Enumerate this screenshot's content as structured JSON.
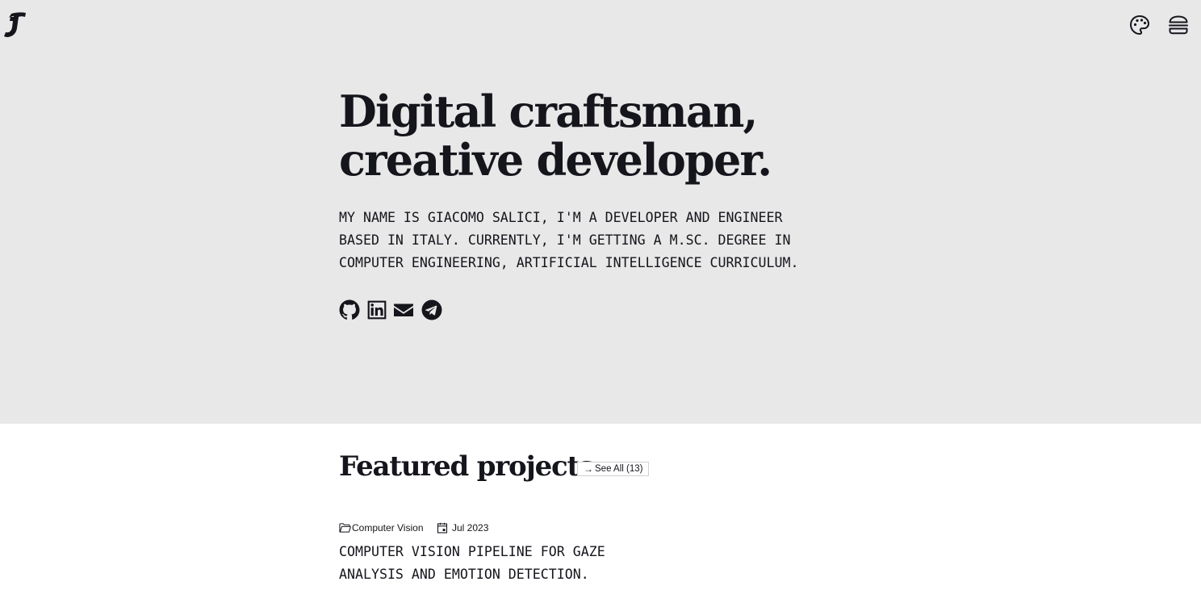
{
  "header": {
    "logo_icon": "script-j-logo-icon",
    "palette_icon": "palette-icon",
    "menu_icon": "hamburger-menu-icon"
  },
  "hero": {
    "headline_line1": "Digital craftsman,",
    "headline_line2": "creative developer.",
    "intro": "MY NAME IS GIACOMO SALICI, I'M A DEVELOPER AND ENGINEER BASED IN ITALY. CURRENTLY, I'M GETTING A M.SC. DEGREE IN COMPUTER ENGINEERING, ARTIFICIAL INTELLIGENCE CURRICULUM.",
    "socials": [
      "github-icon",
      "linkedin-icon",
      "mail-icon",
      "telegram-icon"
    ],
    "background": "#e8e8e8"
  },
  "featured": {
    "title": "Featured projects",
    "see_all_label": "See All (13)",
    "projects": [
      {
        "category": "Computer Vision",
        "date": "Jul 2023",
        "description": "COMPUTER VISION PIPELINE FOR GAZE ANALYSIS AND EMOTION DETECTION."
      }
    ]
  },
  "colors": {
    "text": "#15151c",
    "hero_bg": "#e8e8e8",
    "page_bg": "#ffffff"
  }
}
